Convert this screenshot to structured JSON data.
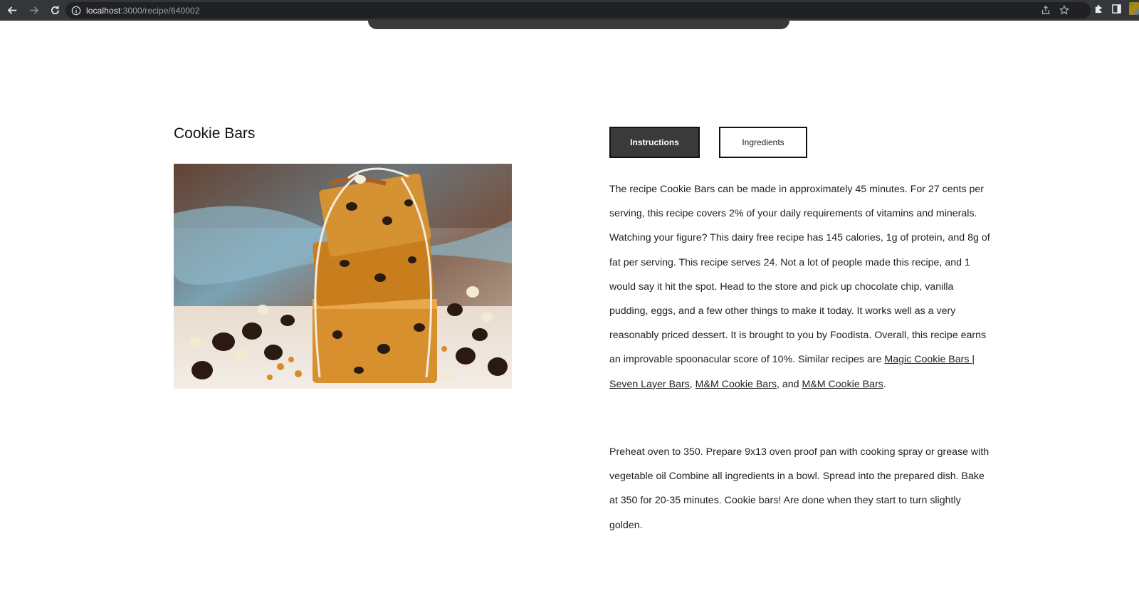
{
  "browser": {
    "url_host": "localhost",
    "url_path": ":3000/recipe/640002"
  },
  "recipe": {
    "title": "Cookie Bars",
    "image_alt": "Stack of cookie bars tied with string surrounded by chocolate chips"
  },
  "tabs": {
    "instructions_label": "Instructions",
    "ingredients_label": "Ingredients",
    "active": "Instructions"
  },
  "summary": {
    "intro": "The recipe Cookie Bars can be made in approximately 45 minutes. For 27 cents per serving, this recipe covers 2% of your daily requirements of vitamins and minerals. Watching your figure? This dairy free recipe has 145 calories, 1g of protein, and 8g of fat per serving. This recipe serves 24. Not a lot of people made this recipe, and 1 would say it hit the spot. Head to the store and pick up chocolate chip, vanilla pudding, eggs, and a few other things to make it today. It works well as a very reasonably priced dessert. It is brought to you by Foodista. Overall, this recipe earns an improvable spoonacular score of 10%. Similar recipes are ",
    "link1": "Magic Cookie Bars | Seven Layer Bars",
    "sep1": ", ",
    "link2": "M&M Cookie Bars",
    "sep2": ", and ",
    "link3": "M&M Cookie Bars",
    "end": "."
  },
  "instructions": {
    "text": "Preheat oven to 350. Prepare 9x13 oven proof pan with cooking spray or grease with vegetable oil Combine all ingredients in a bowl. Spread into the prepared dish. Bake at 350 for 20-35 minutes. Cookie bars! Are done when they start to turn slightly golden."
  },
  "icons": {
    "back": "arrow-left-icon",
    "forward": "arrow-right-icon",
    "reload": "reload-icon",
    "info": "info-icon",
    "share": "share-icon",
    "bookmark": "star-icon",
    "extensions": "puzzle-icon",
    "sidepanel": "side-panel-icon"
  },
  "colors": {
    "chrome_bg": "#35363a",
    "omnibox_bg": "#202124",
    "active_tab_bg": "#3a3a3a",
    "text": "#222222"
  }
}
